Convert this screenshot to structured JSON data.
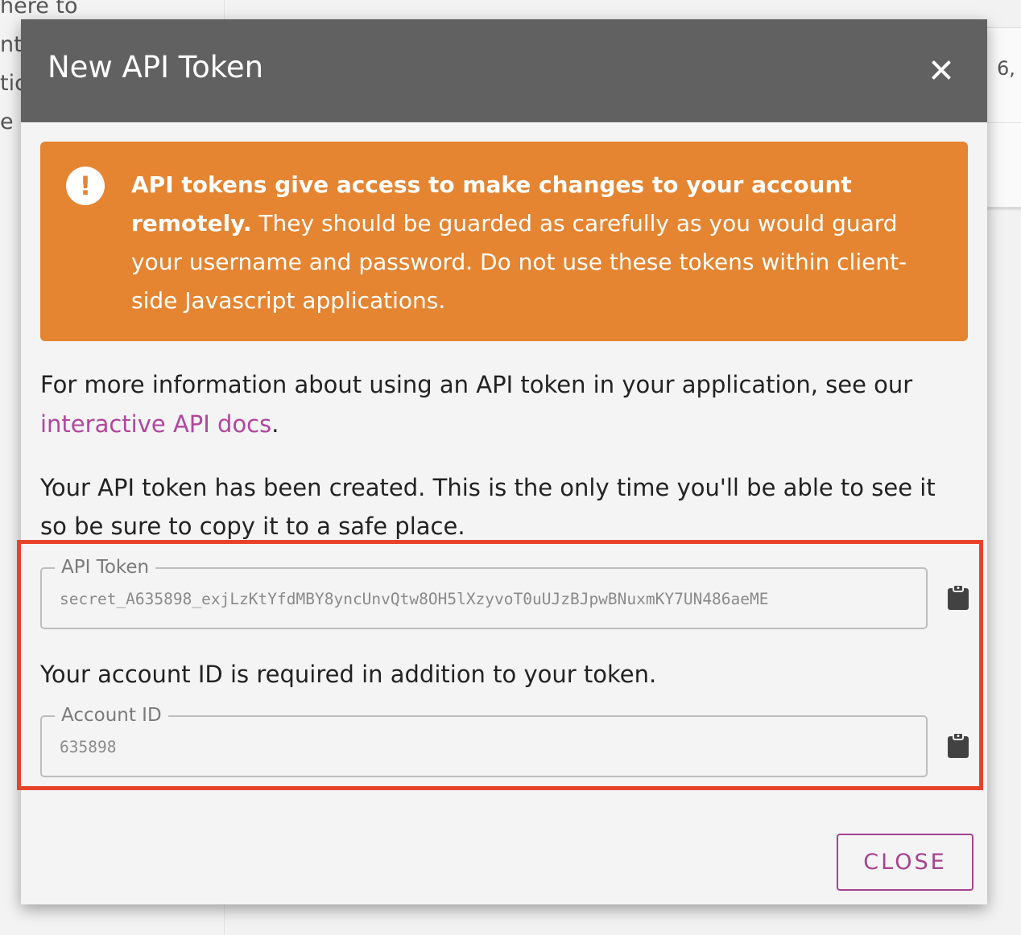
{
  "background": {
    "left_lines": [
      "here to",
      "nt",
      "tic",
      "e c"
    ],
    "right_text": "6,"
  },
  "modal": {
    "title": "New API Token",
    "close_icon": "close-icon",
    "warning": {
      "icon": "exclamation-icon",
      "bold": "API tokens give access to make changes to your account remotely.",
      "body": " They should be guarded as carefully as you would guard your username and password. Do not use these tokens within client-side Javascript applications."
    },
    "info": {
      "text": "For more information about using an API token in your application, see our ",
      "link": "interactive API docs",
      "suffix": "."
    },
    "created_text": "Your API token has been created. This is the only time you'll be able to see it so be sure to copy it to a safe place.",
    "token_field": {
      "label": "API Token",
      "value": "secret_A635898_exjLzKtYfdMBY8yncUnvQtw8OH5lXzyvoT0uUJzBJpwBNuxmKY7UN486aeME"
    },
    "required_text": "Your account ID is required in addition to your token.",
    "account_field": {
      "label": "Account ID",
      "value": "635898"
    },
    "copy_icon": "clipboard-icon",
    "close_button": "CLOSE"
  },
  "colors": {
    "header": "#616161",
    "warning": "#e58431",
    "link": "#b1479e",
    "highlight": "#e8432a"
  }
}
